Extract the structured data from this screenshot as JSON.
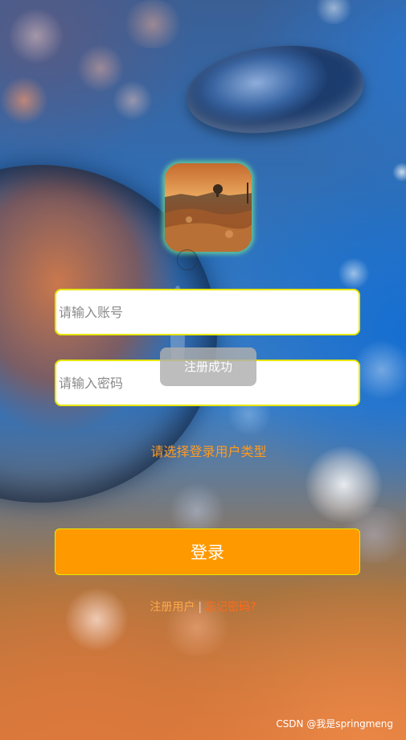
{
  "login": {
    "account_placeholder": "请输入账号",
    "password_placeholder": "请输入密码",
    "user_type_prompt": "请选择登录用户类型",
    "login_button": "登录",
    "register_link": "注册用户",
    "link_divider": "|",
    "forgot_password_link": "忘记密码?"
  },
  "toast": {
    "message": "注册成功"
  },
  "avatar": {
    "icon": "landscape-avatar-icon"
  },
  "watermark": {
    "text": "CSDN @我是springmeng"
  },
  "colors": {
    "accent_orange": "#ff9900",
    "input_border_yellow": "#e6e600",
    "user_type_text": "#ff9a20",
    "forgot_link": "#ff6a1a",
    "avatar_glow": "#6edc96"
  }
}
